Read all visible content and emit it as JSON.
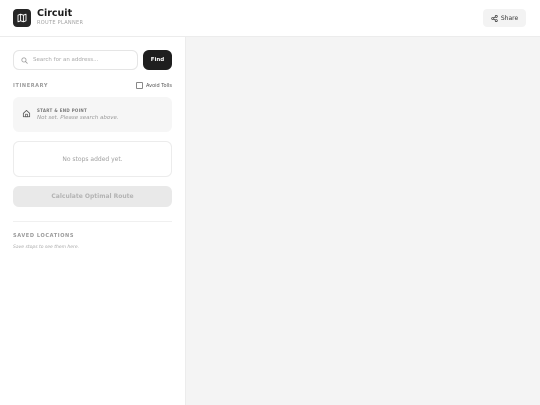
{
  "header": {
    "title": "Circuit",
    "subtitle": "ROUTE PLANNER",
    "share_label": "Share"
  },
  "search": {
    "placeholder": "Search for an address...",
    "value": "",
    "find_label": "Find"
  },
  "itinerary": {
    "label": "ITINERARY",
    "avoid_tolls_label": "Avoid Tolls",
    "avoid_tolls_checked": false,
    "start_title": "START & END POINT",
    "start_value": "Not set. Please search above.",
    "stops_empty": "No stops added yet.",
    "calculate_label": "Calculate Optimal Route"
  },
  "saved": {
    "label": "SAVED LOCATIONS",
    "empty": "Save stops to see them here."
  },
  "icons": {
    "logo": "map-icon",
    "share": "share-icon",
    "search": "search-icon",
    "home": "home-icon"
  },
  "colors": {
    "accent": "#1f1f1f",
    "map_background": "#f4f4f4"
  }
}
